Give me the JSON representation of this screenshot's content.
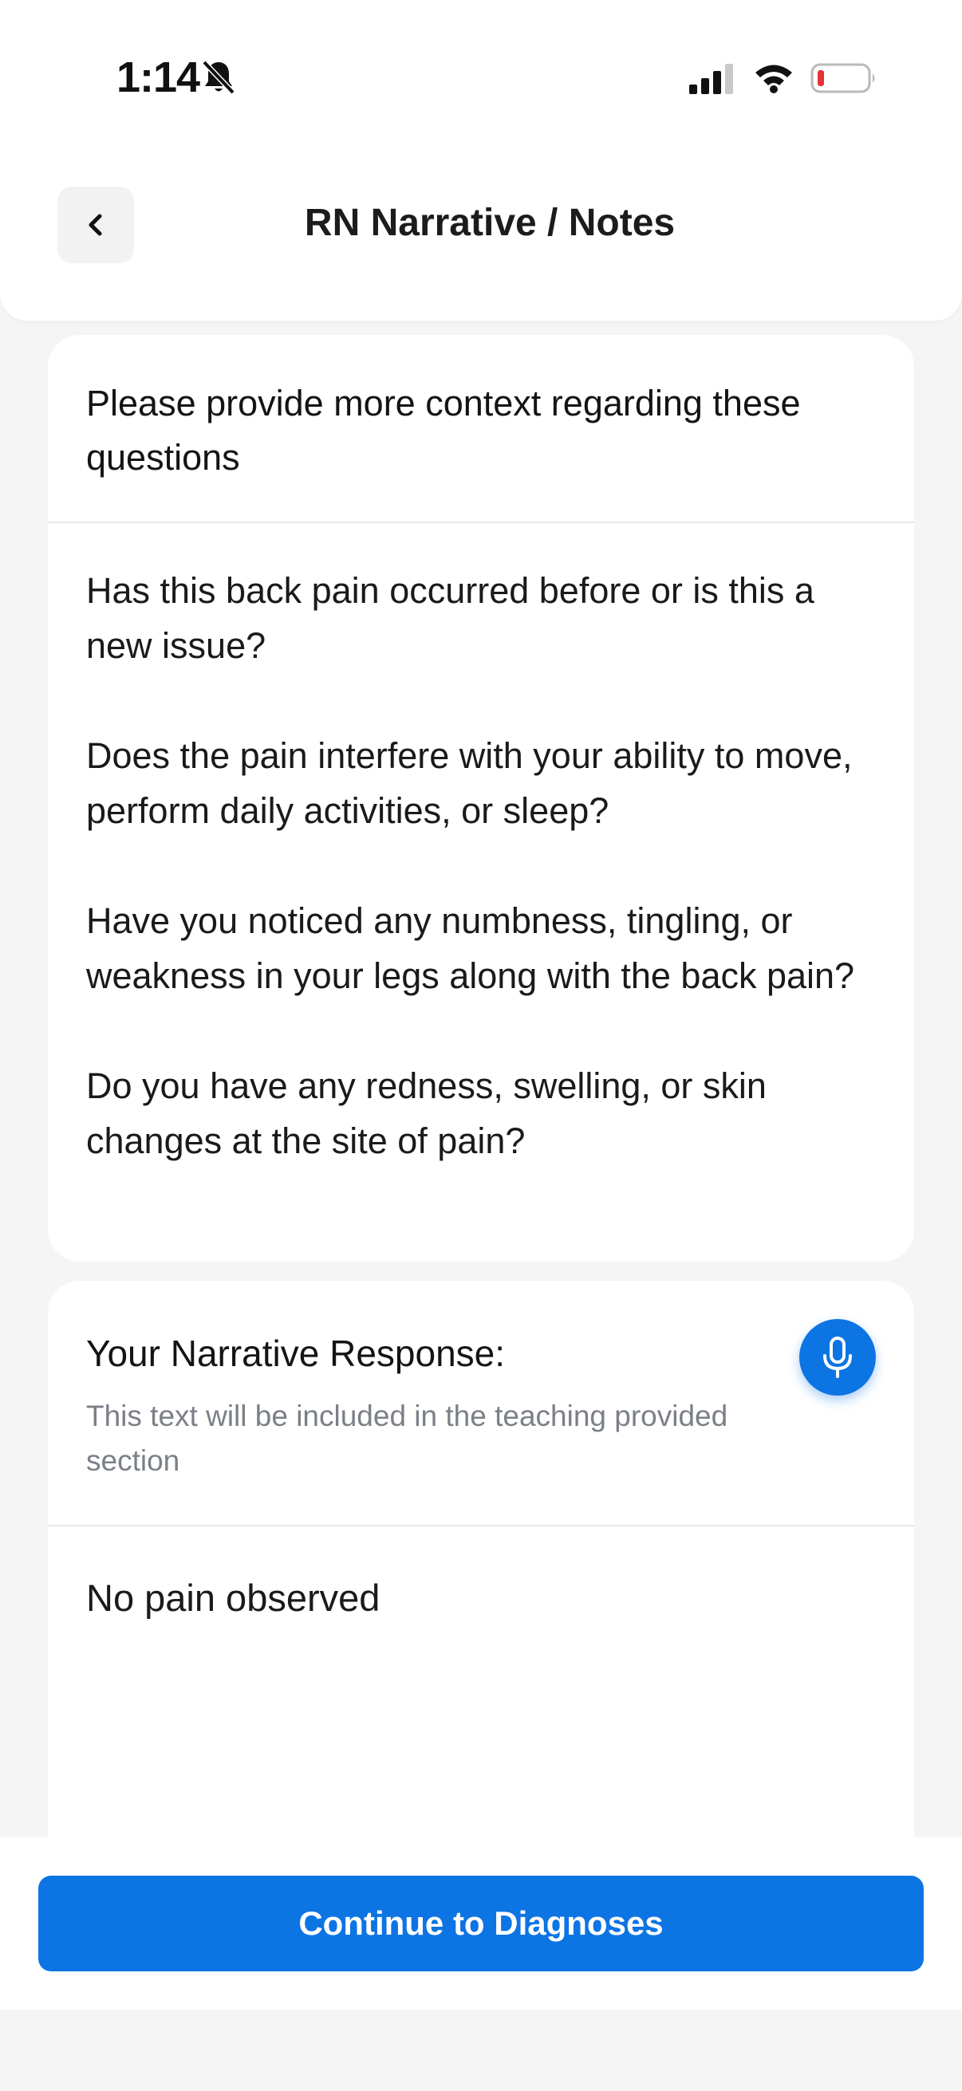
{
  "status_bar": {
    "time": "1:14",
    "icons": [
      "bell-slash-icon",
      "signal-icon",
      "wifi-icon",
      "battery-low-icon"
    ]
  },
  "header": {
    "title": "RN Narrative / Notes",
    "back_icon": "chevron-left-icon"
  },
  "context_card": {
    "heading": "Please provide more context regarding these questions",
    "questions": [
      "Has this back pain occurred before or is this a new issue?",
      "Does the pain interfere with your ability to move, perform daily activities, or sleep?",
      "Have you noticed any numbness, tingling, or weakness in your legs along with the back pain?",
      "Do you have any redness, swelling, or skin changes at the site of pain?"
    ]
  },
  "response_card": {
    "title": "Your Narrative Response:",
    "subtitle": "This text will be included in the teaching provided section",
    "mic_icon": "microphone-icon",
    "value": "No pain observed"
  },
  "footer": {
    "continue_label": "Continue to Diagnoses"
  },
  "colors": {
    "accent": "#0D74E4",
    "background": "#F5F5F6",
    "battery_low": "#E5343A"
  }
}
